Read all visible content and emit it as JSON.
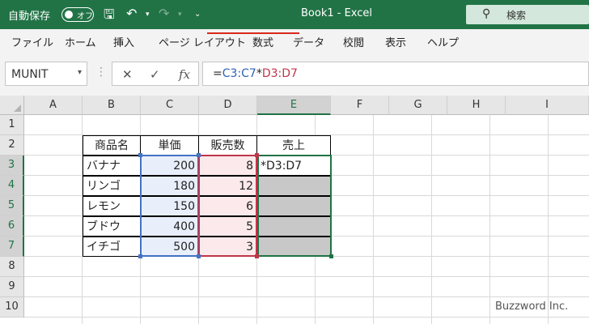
{
  "titlebar": {
    "autosave_label": "自動保存",
    "autosave_state": "オフ",
    "doc_title": "Book1  -  Excel",
    "search_placeholder": "検索"
  },
  "ribbon": {
    "tabs": [
      "ファイル",
      "ホーム",
      "挿入",
      "ページ レイアウト",
      "数式",
      "データ",
      "校閲",
      "表示",
      "ヘルプ"
    ]
  },
  "formula_bar": {
    "name_box": "MUNIT",
    "formula": {
      "eq": "=",
      "range1": "C3:C7",
      "op": "*",
      "range2": "D3:D7"
    },
    "fx": "fx"
  },
  "grid": {
    "columns": [
      "A",
      "B",
      "C",
      "D",
      "E",
      "F",
      "G",
      "H",
      "I"
    ],
    "rows": [
      "1",
      "2",
      "3",
      "4",
      "5",
      "6",
      "7",
      "8",
      "9",
      "10"
    ],
    "headers": [
      "商品名",
      "単価",
      "販売数",
      "売上"
    ],
    "table": [
      {
        "name": "バナナ",
        "price": "200",
        "qty": "8",
        "sales": "*D3:D7"
      },
      {
        "name": "リンゴ",
        "price": "180",
        "qty": "12",
        "sales": ""
      },
      {
        "name": "レモン",
        "price": "150",
        "qty": "6",
        "sales": ""
      },
      {
        "name": "ブドウ",
        "price": "400",
        "qty": "5",
        "sales": ""
      },
      {
        "name": "イチゴ",
        "price": "500",
        "qty": "3",
        "sales": ""
      }
    ]
  },
  "watermark": "Buzzword Inc.",
  "colors": {
    "excel_green": "#217346",
    "range_blue": "#4472c4",
    "range_red": "#c0354a",
    "underline_red": "#d9291c"
  }
}
